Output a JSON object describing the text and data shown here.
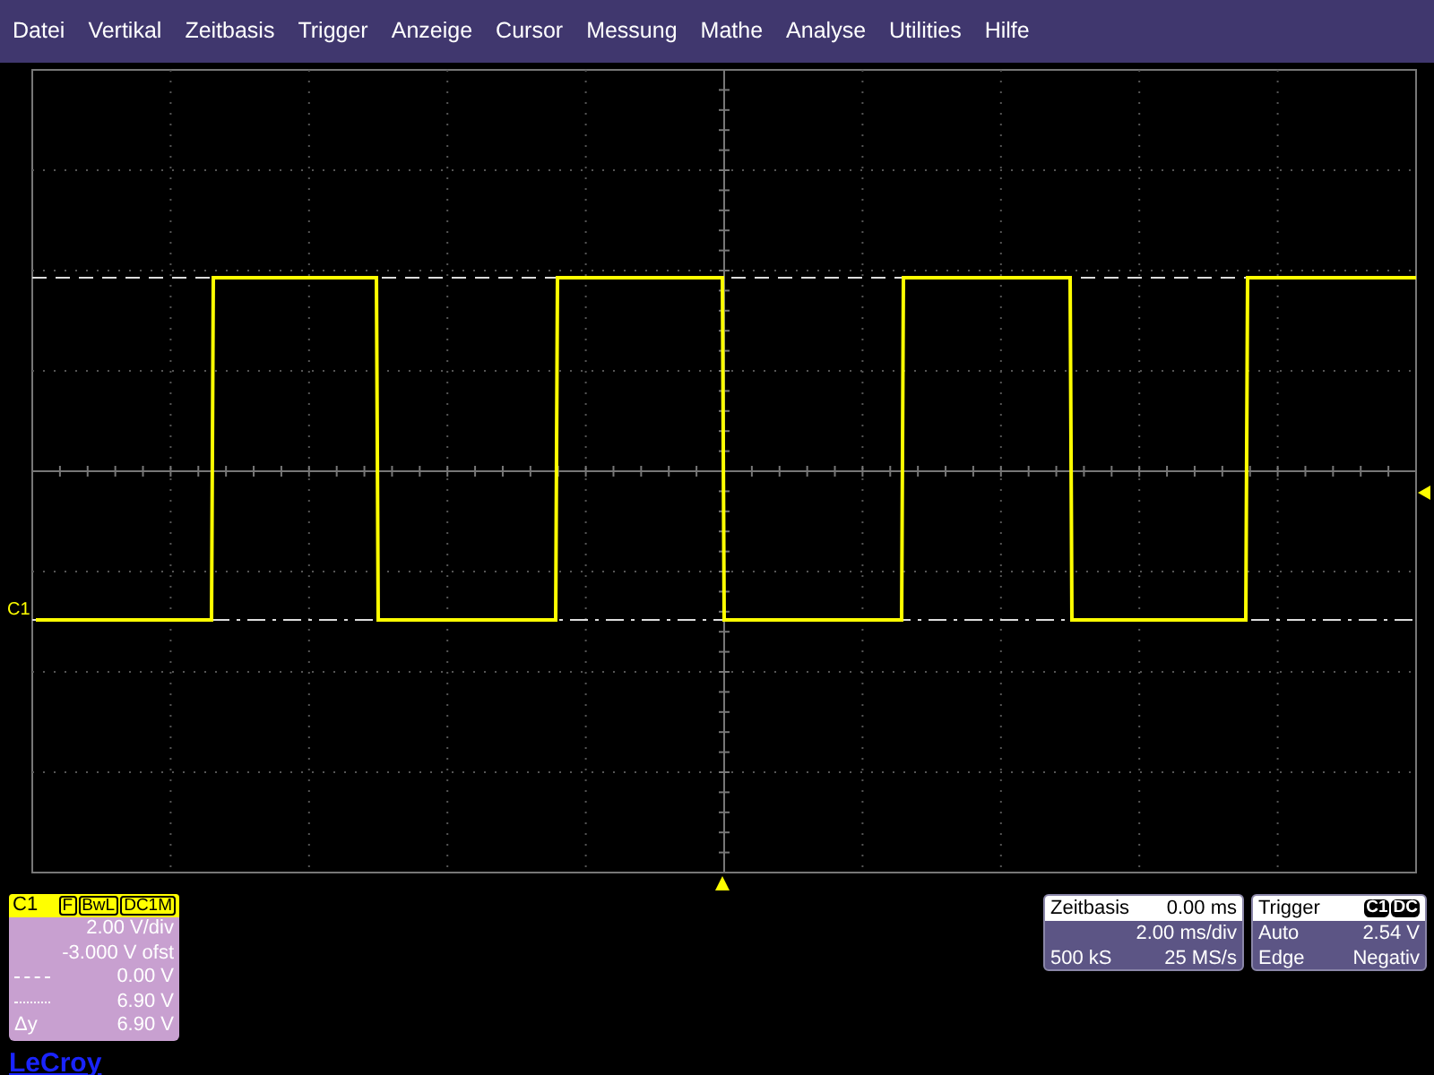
{
  "menu_bar": {
    "items": [
      "Datei",
      "Vertikal",
      "Zeitbasis",
      "Trigger",
      "Anzeige",
      "Cursor",
      "Messung",
      "Mathe",
      "Analyse",
      "Utilities",
      "Hilfe"
    ]
  },
  "screen": {
    "channel_label": "C1"
  },
  "channel_box": {
    "title": "C1",
    "badges": [
      "F",
      "BwL",
      "DC1M"
    ],
    "rows": [
      {
        "kind": "text",
        "label": "",
        "value": "2.00 V/div"
      },
      {
        "kind": "text",
        "label": "",
        "value": "-3.000 V ofst"
      },
      {
        "kind": "dashdot",
        "value": "0.00 V"
      },
      {
        "kind": "dashed",
        "value": "6.90 V"
      },
      {
        "kind": "text",
        "label": "Δy",
        "value": "6.90 V"
      }
    ]
  },
  "brand": "LeCroy",
  "timebase_box": {
    "title": "Zeitbasis",
    "title_value": "0.00 ms",
    "rows": [
      [
        "",
        "2.00 ms/div"
      ],
      [
        "500 kS",
        "25 MS/s"
      ]
    ]
  },
  "trigger_box": {
    "title": "Trigger",
    "badges": [
      "C1",
      "DC"
    ],
    "rows": [
      [
        "Auto",
        "2.54 V"
      ],
      [
        "Edge",
        "Negativ"
      ]
    ]
  }
}
